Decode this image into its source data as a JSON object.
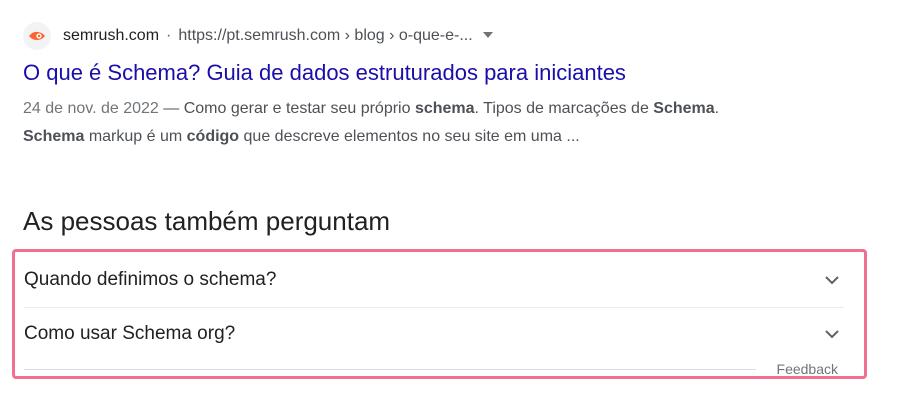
{
  "result": {
    "site_name": "semrush.com",
    "separator": "·",
    "url": "https://pt.semrush.com › blog › o-que-e-...",
    "title": "O que é Schema? Guia de dados estruturados para iniciantes",
    "date": "24 de nov. de 2022",
    "snippet_parts": [
      {
        "t": " — Como gerar e testar seu próprio ",
        "b": false
      },
      {
        "t": "schema",
        "b": true
      },
      {
        "t": ". Tipos de marcações de ",
        "b": false
      },
      {
        "t": "Schema",
        "b": true
      },
      {
        "t": ". ",
        "b": false
      },
      {
        "t": "Schema",
        "b": true
      },
      {
        "t": " markup é um ",
        "b": false
      },
      {
        "t": "código",
        "b": true
      },
      {
        "t": " que descreve elementos no seu site em uma ...",
        "b": false
      }
    ],
    "favicon_icon": "semrush-logo-icon",
    "favicon_color": "#ff642d"
  },
  "paa": {
    "heading": "As pessoas também perguntam",
    "questions": [
      "Quando definimos o schema?",
      "Como usar Schema org?"
    ],
    "feedback_label": "Feedback",
    "highlight_color": "#f0708f",
    "chevron_icon": "chevron-down-icon"
  }
}
